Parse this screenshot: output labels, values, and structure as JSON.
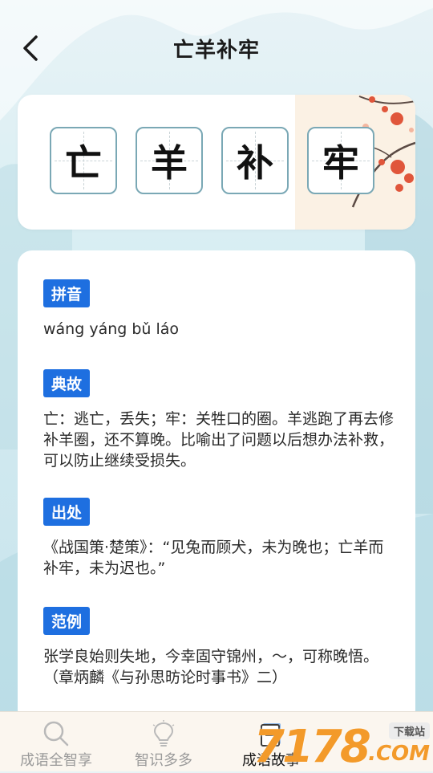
{
  "header": {
    "title": "亡羊补牢"
  },
  "idiom": {
    "chars": [
      "亡",
      "羊",
      "补",
      "牢"
    ]
  },
  "sections": [
    {
      "tag": "拼音",
      "text": "wáng yáng bǔ láo"
    },
    {
      "tag": "典故",
      "text": "亡：逃亡，丢失；牢：关牲口的圈。羊逃跑了再去修补羊圈，还不算晚。比喻出了问题以后想办法补救，可以防止继续受损失。"
    },
    {
      "tag": "出处",
      "text": "《战国策·楚策》：“见兔而顾犬，未为晚也；亡羊而补牢，未为迟也。”"
    },
    {
      "tag": "范例",
      "text": "张学良始则失地，今幸固守锦州，～，可称晚悟。（章炳麟《与孙思昉论时事书》二）"
    }
  ],
  "nav": {
    "items": [
      {
        "label": "成语全智享",
        "icon": "search-icon",
        "active": false
      },
      {
        "label": "智识多多",
        "icon": "lightbulb-icon",
        "active": false
      },
      {
        "label": "成语故事",
        "icon": "book-icon",
        "active": true
      }
    ]
  },
  "watermark": {
    "text": "7178",
    "com": ".COM",
    "badge": "下载站"
  },
  "colors": {
    "tag_bg": "#1e6fe0",
    "card_border": "#7aa8b5",
    "nav_active": "#111111",
    "nav_inactive": "#9a9a9a"
  }
}
